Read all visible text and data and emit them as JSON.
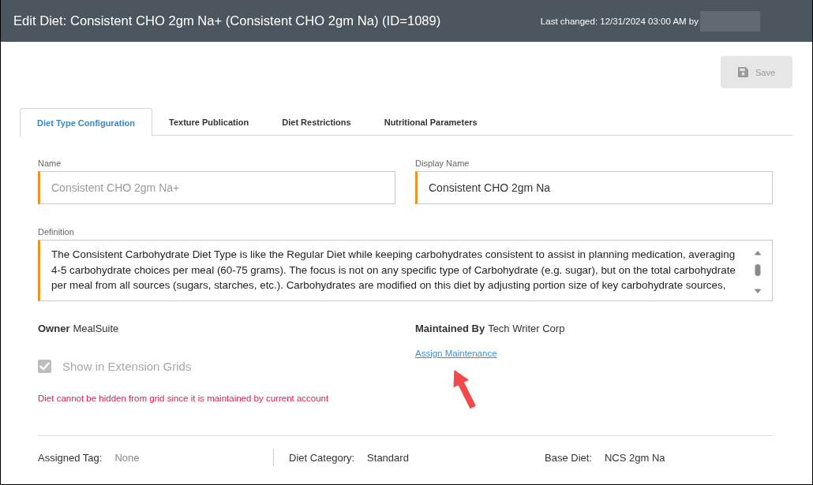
{
  "header": {
    "title": "Edit Diet: Consistent CHO 2gm Na+ (Consistent CHO 2gm Na) (ID=1089)",
    "last_changed": "Last changed: 12/31/2024 03:00 AM by"
  },
  "save_button": {
    "label": "Save",
    "disabled": true
  },
  "tabs": [
    {
      "label": "Diet Type Configuration",
      "selected": true
    },
    {
      "label": "Texture Publication",
      "selected": false
    },
    {
      "label": "Diet Restrictions",
      "selected": false
    },
    {
      "label": "Nutritional Parameters",
      "selected": false
    }
  ],
  "fields": [
    {
      "label": "Name",
      "value": "Consistent CHO 2gm Na+",
      "disabled": true,
      "required": true
    },
    {
      "label": "Display Name",
      "value": "Consistent CHO 2gm Na",
      "disabled": false,
      "required": true
    }
  ],
  "definition": {
    "label": "Definition",
    "value": "The Consistent Carbohydrate Diet Type is like the Regular Diet while keeping carbohydrates consistent to assist in planning medication, averaging 4-5 carbohydrate choices per meal (60-75 grams). The focus is not on any specific type of Carbohydrate (e.g. sugar), but on the total carbohydrate per meal from all sources (sugars, starches, etc.). Carbohydrates are modified on this diet by adjusting portion size of key carbohydrate sources,",
    "required": true
  },
  "owner": {
    "label": "Owner",
    "value": "MealSuite"
  },
  "maintained_by": {
    "label": "Maintained By",
    "value": "Tech Writer Corp",
    "link": "Assign Maintenance"
  },
  "show_in_extension_grids": {
    "label": "Show in Extension Grids",
    "checked": true,
    "disabled": true
  },
  "warning": "Diet cannot be hidden from grid since it is maintained by current account",
  "annotation": {
    "kind": "arrow"
  },
  "footer": [
    {
      "label": "Assigned Tag:",
      "value": "None",
      "muted": true
    },
    {
      "label": "Diet Category:",
      "value": "Standard",
      "muted": false
    },
    {
      "label": "Base Diet:",
      "value": "NCS 2gm Na",
      "muted": false
    }
  ]
}
